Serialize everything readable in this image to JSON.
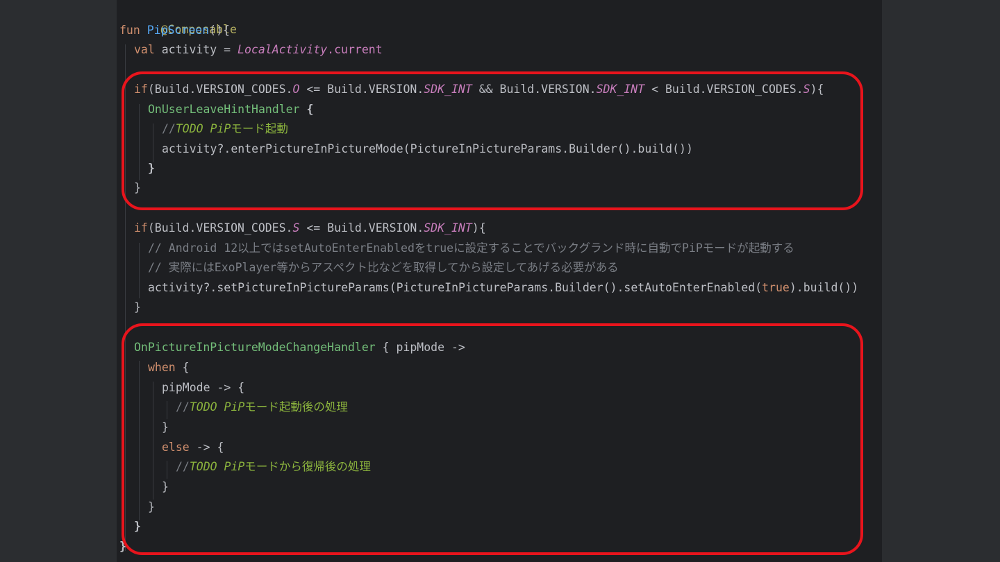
{
  "code": {
    "annotation": "@Composable",
    "fun_kw": "fun",
    "fun_name": "PipScreen",
    "fun_tail": "(){",
    "val_kw": "val",
    "val_rest": " activity = ",
    "local_activity": "LocalActivity",
    "current_tail": ".current",
    "if1_kw": "if",
    "if1_a": "(Build.VERSION_CODES.",
    "if1_o": "O",
    "if1_b": " <= Build.VERSION.",
    "if1_sdk1": "SDK_INT",
    "if1_c": " && Build.VERSION.",
    "if1_sdk2": "SDK_INT",
    "if1_d": " < Build.VERSION_CODES.",
    "if1_s": "S",
    "if1_e": "){",
    "user_leave_handler": "OnUserLeaveHintHandler",
    "brace_open": " {",
    "comment1_prefix": "//",
    "todo1": "TODO PiP",
    "todo1_rest": "モード起動",
    "enter_pip_line": "activity?.enterPictureInPictureMode(PictureInPictureParams.Builder().build())",
    "close_brace": "}",
    "if2_kw": "if",
    "if2_a": "(Build.VERSION_CODES.",
    "if2_s": "S",
    "if2_b": " <= Build.VERSION.",
    "if2_sdk": "SDK_INT",
    "if2_c": "){",
    "comment2": "// Android 12以上ではsetAutoEnterEnabledをtrueに設定することでバックグランド時に自動でPiPモードが起動する",
    "comment3": "// 実際にはExoPlayer等からアスペクト比などを取得してから設定してあげる必要がある",
    "set_params_a": "activity?.setPictureInPictureParams(PictureInPictureParams.Builder().setAutoEnterEnabled(",
    "true_kw": "true",
    "set_params_b": ").build())",
    "pip_change_handler": "OnPictureInPictureModeChangeHandler",
    "pip_change_rest": " { pipMode ->",
    "when_kw": "when",
    "when_rest": " {",
    "pipmode_branch": "pipMode -> {",
    "todo2": "TODO PiP",
    "todo2_rest": "モード起動後の処理",
    "else_kw": "else",
    "else_rest": " -> {",
    "todo3": "TODO PiP",
    "todo3_rest": "モードから復帰後の処理"
  },
  "colors": {
    "highlight_border": "#e8141c",
    "editor_bg": "#1e1f22",
    "keyword": "#cf8e6d",
    "function": "#56a8f5",
    "annotation": "#b3ae60",
    "todo": "#8bb33d",
    "comment": "#7a7e85"
  }
}
